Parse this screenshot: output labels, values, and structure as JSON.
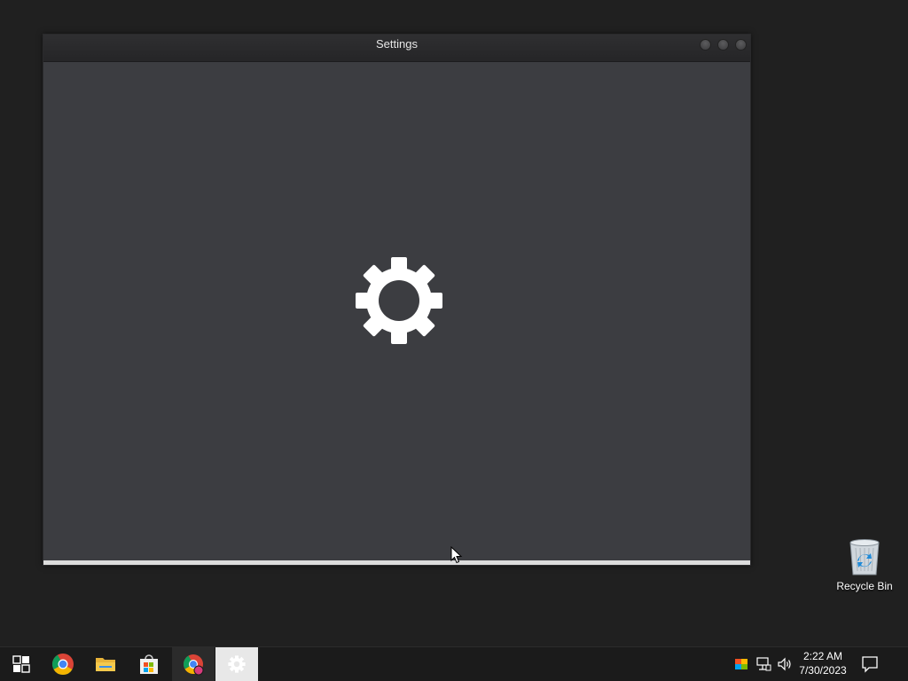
{
  "window": {
    "title": "Settings",
    "loading_progress": 1.0
  },
  "desktop": {
    "icons": [
      {
        "label": "Recycle Bin",
        "icon": "recycle-bin-icon"
      }
    ]
  },
  "taskbar": {
    "items": [
      {
        "name": "start",
        "icon": "start-icon"
      },
      {
        "name": "chrome",
        "icon": "chrome-icon"
      },
      {
        "name": "file-explorer",
        "icon": "folder-icon"
      },
      {
        "name": "microsoft-store",
        "icon": "store-icon"
      },
      {
        "name": "chrome-profile",
        "icon": "chrome-profile-icon"
      },
      {
        "name": "settings",
        "icon": "gear-icon"
      }
    ],
    "tray": {
      "icons": [
        "color-flag-icon",
        "network-icon",
        "volume-icon"
      ],
      "time": "2:22 AM",
      "date": "7/30/2023"
    }
  },
  "colors": {
    "desktop_bg": "#202020",
    "window_bg": "#3c3d41",
    "taskbar_bg": "#1b1b1b",
    "active_item": "#e8e8e8"
  }
}
